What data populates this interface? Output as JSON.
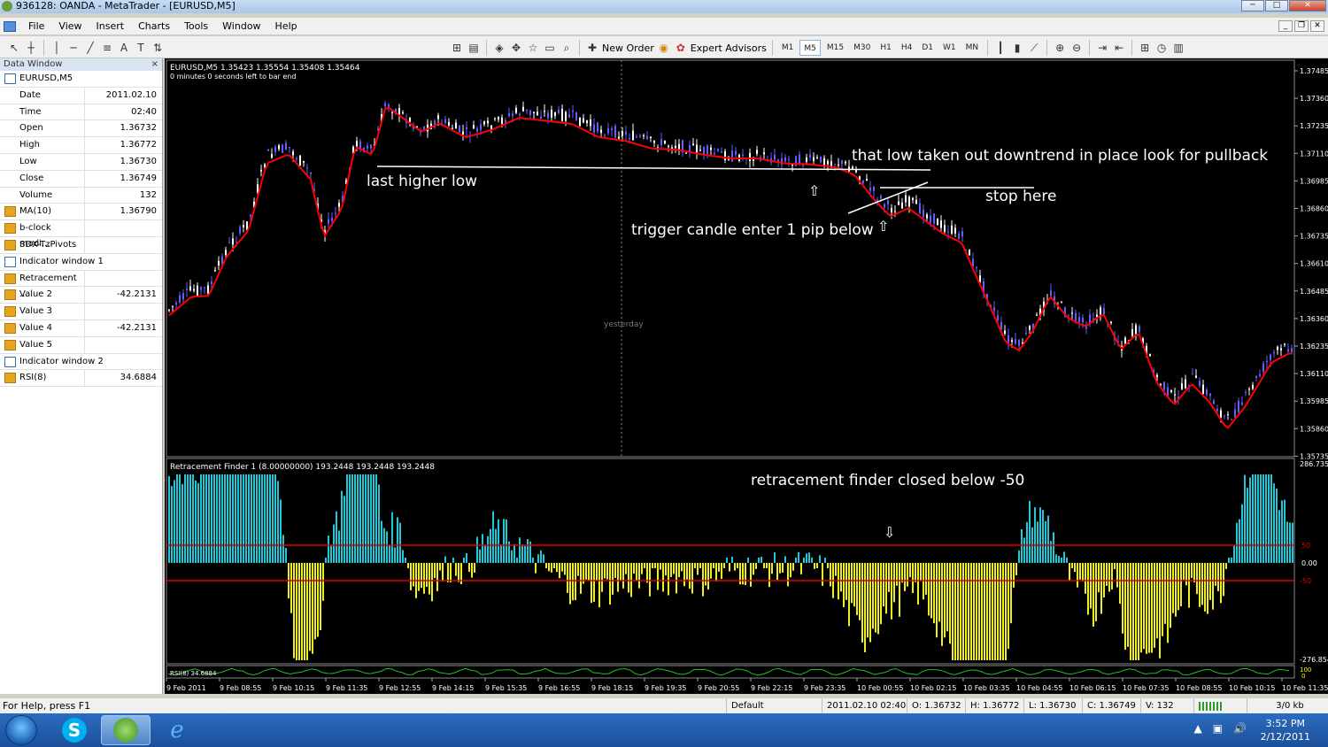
{
  "window": {
    "title": "936128: OANDA - MetaTrader - [EURUSD,M5]",
    "min": "─",
    "max": "□",
    "close": "✕"
  },
  "menu": [
    "File",
    "View",
    "Insert",
    "Charts",
    "Tools",
    "Window",
    "Help"
  ],
  "mdi": {
    "min": "_",
    "restore": "❐",
    "close": "✕"
  },
  "toolbar": {
    "new_order": "New Order",
    "expert_advisors": "Expert Advisors",
    "font_a": "A",
    "text_t": "T",
    "timeframes": [
      "M1",
      "M5",
      "M15",
      "M30",
      "H1",
      "H4",
      "D1",
      "W1",
      "MN"
    ],
    "active_timeframe": "M5"
  },
  "data_window": {
    "title": "Data Window",
    "close": "×",
    "symbol": "EURUSD,M5",
    "rows": [
      {
        "k": "Date",
        "v": "2011.02.10"
      },
      {
        "k": "Time",
        "v": "02:40"
      },
      {
        "k": "Open",
        "v": "1.36732"
      },
      {
        "k": "High",
        "v": "1.36772"
      },
      {
        "k": "Low",
        "v": "1.36730"
      },
      {
        "k": "Close",
        "v": "1.36749"
      },
      {
        "k": "Volume",
        "v": "132"
      },
      {
        "k": "MA(10)",
        "v": "1.36790"
      },
      {
        "k": "b-clock modi...",
        "v": ""
      },
      {
        "k": "SDX-TzPivots",
        "v": ""
      },
      {
        "k": "Indicator window 1",
        "v": ""
      },
      {
        "k": "Retracement ...",
        "v": ""
      },
      {
        "k": "Value 2",
        "v": "-42.2131"
      },
      {
        "k": "Value 3",
        "v": ""
      },
      {
        "k": "Value 4",
        "v": "-42.2131"
      },
      {
        "k": "Value 5",
        "v": ""
      },
      {
        "k": "Indicator window 2",
        "v": ""
      },
      {
        "k": "RSI(8)",
        "v": "34.6884"
      }
    ]
  },
  "chart": {
    "header": "EURUSD,M5  1.35423 1.35554 1.35408 1.35464",
    "subheader": "0 minutes 0 seconds left to bar end",
    "separator_label": "yesterday",
    "price_ticks": [
      "1.37485",
      "1.37360",
      "1.37235",
      "1.37110",
      "1.36985",
      "1.36860",
      "1.36735",
      "1.36610",
      "1.36485",
      "1.36360",
      "1.36235",
      "1.36110",
      "1.35985",
      "1.35860",
      "1.35735"
    ],
    "annotations": {
      "last_higher_low": "last higher low",
      "downtrend": "that low taken out downtrend in place look for pullback",
      "stop_here": "stop here",
      "trigger": "trigger candle enter 1 pip below",
      "retracement": "retracement finder closed below -50"
    },
    "indicator_header": "Retracement Finder 1 (8.00000000) 193.2448 193.2448 193.2448",
    "indicator_ticks": {
      "top": "286.7358",
      "zero": "0.00",
      "bottom": "-276.854",
      "upper_level": "50",
      "lower_level": "-50"
    },
    "rsi_label": "RSI(8) 34.6884",
    "rsi_ticks": {
      "top": "100",
      "bottom": "0"
    },
    "time_ticks": [
      "9 Feb 2011",
      "9 Feb 08:55",
      "9 Feb 10:15",
      "9 Feb 11:35",
      "9 Feb 12:55",
      "9 Feb 14:15",
      "9 Feb 15:35",
      "9 Feb 16:55",
      "9 Feb 18:15",
      "9 Feb 19:35",
      "9 Feb 20:55",
      "9 Feb 22:15",
      "9 Feb 23:35",
      "10 Feb 00:55",
      "10 Feb 02:15",
      "10 Feb 03:35",
      "10 Feb 04:55",
      "10 Feb 06:15",
      "10 Feb 07:35",
      "10 Feb 08:55",
      "10 Feb 10:15",
      "10 Feb 11:35"
    ],
    "colors": {
      "ma": "#ff0000",
      "bull": "#6060ff",
      "bear": "#ffffff",
      "hist_pos": "#22c8d8",
      "hist_neg": "#f0f020",
      "level": "#e00000"
    }
  },
  "status": {
    "help": "For Help, press F1",
    "profile": "Default",
    "time": "2011.02.10 02:40",
    "open": "O: 1.36732",
    "high": "H: 1.36772",
    "low": "L: 1.36730",
    "close": "C: 1.36749",
    "volume": "V: 132",
    "traffic": "3/0 kb"
  },
  "taskbar": {
    "time": "3:52 PM",
    "date": "2/12/2011",
    "skype": "S",
    "ie": "e"
  }
}
